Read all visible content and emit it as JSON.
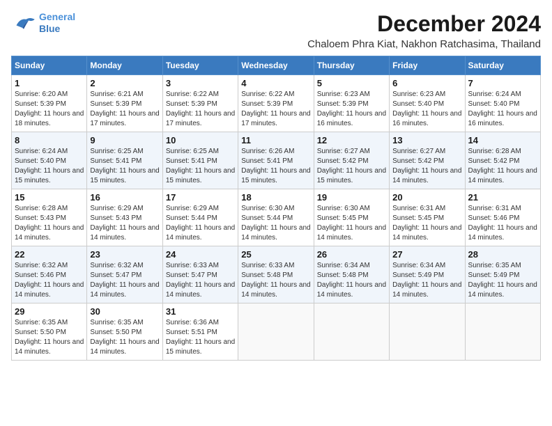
{
  "header": {
    "logo_line1": "General",
    "logo_line2": "Blue",
    "month_title": "December 2024",
    "subtitle": "Chaloem Phra Kiat, Nakhon Ratchasima, Thailand"
  },
  "days_of_week": [
    "Sunday",
    "Monday",
    "Tuesday",
    "Wednesday",
    "Thursday",
    "Friday",
    "Saturday"
  ],
  "weeks": [
    [
      {
        "day": "1",
        "sunrise": "Sunrise: 6:20 AM",
        "sunset": "Sunset: 5:39 PM",
        "daylight": "Daylight: 11 hours and 18 minutes."
      },
      {
        "day": "2",
        "sunrise": "Sunrise: 6:21 AM",
        "sunset": "Sunset: 5:39 PM",
        "daylight": "Daylight: 11 hours and 17 minutes."
      },
      {
        "day": "3",
        "sunrise": "Sunrise: 6:22 AM",
        "sunset": "Sunset: 5:39 PM",
        "daylight": "Daylight: 11 hours and 17 minutes."
      },
      {
        "day": "4",
        "sunrise": "Sunrise: 6:22 AM",
        "sunset": "Sunset: 5:39 PM",
        "daylight": "Daylight: 11 hours and 17 minutes."
      },
      {
        "day": "5",
        "sunrise": "Sunrise: 6:23 AM",
        "sunset": "Sunset: 5:39 PM",
        "daylight": "Daylight: 11 hours and 16 minutes."
      },
      {
        "day": "6",
        "sunrise": "Sunrise: 6:23 AM",
        "sunset": "Sunset: 5:40 PM",
        "daylight": "Daylight: 11 hours and 16 minutes."
      },
      {
        "day": "7",
        "sunrise": "Sunrise: 6:24 AM",
        "sunset": "Sunset: 5:40 PM",
        "daylight": "Daylight: 11 hours and 16 minutes."
      }
    ],
    [
      {
        "day": "8",
        "sunrise": "Sunrise: 6:24 AM",
        "sunset": "Sunset: 5:40 PM",
        "daylight": "Daylight: 11 hours and 15 minutes."
      },
      {
        "day": "9",
        "sunrise": "Sunrise: 6:25 AM",
        "sunset": "Sunset: 5:41 PM",
        "daylight": "Daylight: 11 hours and 15 minutes."
      },
      {
        "day": "10",
        "sunrise": "Sunrise: 6:25 AM",
        "sunset": "Sunset: 5:41 PM",
        "daylight": "Daylight: 11 hours and 15 minutes."
      },
      {
        "day": "11",
        "sunrise": "Sunrise: 6:26 AM",
        "sunset": "Sunset: 5:41 PM",
        "daylight": "Daylight: 11 hours and 15 minutes."
      },
      {
        "day": "12",
        "sunrise": "Sunrise: 6:27 AM",
        "sunset": "Sunset: 5:42 PM",
        "daylight": "Daylight: 11 hours and 15 minutes."
      },
      {
        "day": "13",
        "sunrise": "Sunrise: 6:27 AM",
        "sunset": "Sunset: 5:42 PM",
        "daylight": "Daylight: 11 hours and 14 minutes."
      },
      {
        "day": "14",
        "sunrise": "Sunrise: 6:28 AM",
        "sunset": "Sunset: 5:42 PM",
        "daylight": "Daylight: 11 hours and 14 minutes."
      }
    ],
    [
      {
        "day": "15",
        "sunrise": "Sunrise: 6:28 AM",
        "sunset": "Sunset: 5:43 PM",
        "daylight": "Daylight: 11 hours and 14 minutes."
      },
      {
        "day": "16",
        "sunrise": "Sunrise: 6:29 AM",
        "sunset": "Sunset: 5:43 PM",
        "daylight": "Daylight: 11 hours and 14 minutes."
      },
      {
        "day": "17",
        "sunrise": "Sunrise: 6:29 AM",
        "sunset": "Sunset: 5:44 PM",
        "daylight": "Daylight: 11 hours and 14 minutes."
      },
      {
        "day": "18",
        "sunrise": "Sunrise: 6:30 AM",
        "sunset": "Sunset: 5:44 PM",
        "daylight": "Daylight: 11 hours and 14 minutes."
      },
      {
        "day": "19",
        "sunrise": "Sunrise: 6:30 AM",
        "sunset": "Sunset: 5:45 PM",
        "daylight": "Daylight: 11 hours and 14 minutes."
      },
      {
        "day": "20",
        "sunrise": "Sunrise: 6:31 AM",
        "sunset": "Sunset: 5:45 PM",
        "daylight": "Daylight: 11 hours and 14 minutes."
      },
      {
        "day": "21",
        "sunrise": "Sunrise: 6:31 AM",
        "sunset": "Sunset: 5:46 PM",
        "daylight": "Daylight: 11 hours and 14 minutes."
      }
    ],
    [
      {
        "day": "22",
        "sunrise": "Sunrise: 6:32 AM",
        "sunset": "Sunset: 5:46 PM",
        "daylight": "Daylight: 11 hours and 14 minutes."
      },
      {
        "day": "23",
        "sunrise": "Sunrise: 6:32 AM",
        "sunset": "Sunset: 5:47 PM",
        "daylight": "Daylight: 11 hours and 14 minutes."
      },
      {
        "day": "24",
        "sunrise": "Sunrise: 6:33 AM",
        "sunset": "Sunset: 5:47 PM",
        "daylight": "Daylight: 11 hours and 14 minutes."
      },
      {
        "day": "25",
        "sunrise": "Sunrise: 6:33 AM",
        "sunset": "Sunset: 5:48 PM",
        "daylight": "Daylight: 11 hours and 14 minutes."
      },
      {
        "day": "26",
        "sunrise": "Sunrise: 6:34 AM",
        "sunset": "Sunset: 5:48 PM",
        "daylight": "Daylight: 11 hours and 14 minutes."
      },
      {
        "day": "27",
        "sunrise": "Sunrise: 6:34 AM",
        "sunset": "Sunset: 5:49 PM",
        "daylight": "Daylight: 11 hours and 14 minutes."
      },
      {
        "day": "28",
        "sunrise": "Sunrise: 6:35 AM",
        "sunset": "Sunset: 5:49 PM",
        "daylight": "Daylight: 11 hours and 14 minutes."
      }
    ],
    [
      {
        "day": "29",
        "sunrise": "Sunrise: 6:35 AM",
        "sunset": "Sunset: 5:50 PM",
        "daylight": "Daylight: 11 hours and 14 minutes."
      },
      {
        "day": "30",
        "sunrise": "Sunrise: 6:35 AM",
        "sunset": "Sunset: 5:50 PM",
        "daylight": "Daylight: 11 hours and 14 minutes."
      },
      {
        "day": "31",
        "sunrise": "Sunrise: 6:36 AM",
        "sunset": "Sunset: 5:51 PM",
        "daylight": "Daylight: 11 hours and 15 minutes."
      },
      null,
      null,
      null,
      null
    ]
  ]
}
